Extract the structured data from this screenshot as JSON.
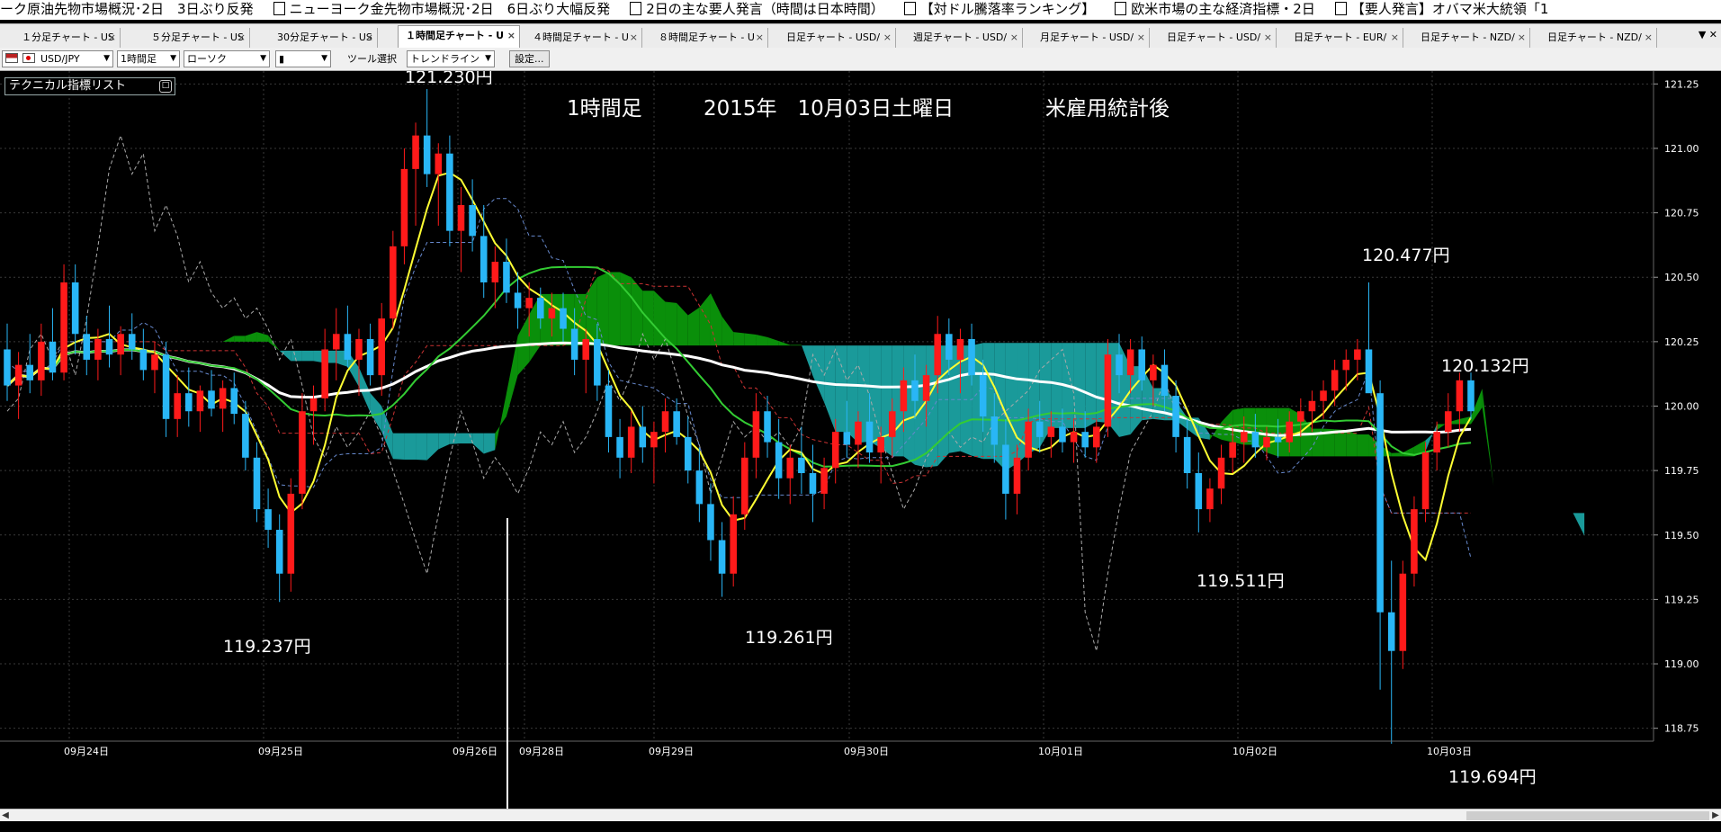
{
  "ticker": [
    "ーク原油先物市場概況･2日　3日ぶり反発",
    "ニューヨーク金先物市場概況･2日　6日ぶり大幅反発",
    "2日の主な要人発言（時間は日本時間）",
    "【対ドル騰落率ランキング】",
    "欧米市場の主な経済指標・2日",
    "【要人発言】オバマ米大統領「1"
  ],
  "tabs": [
    {
      "label": "１分足チャート - US",
      "x": 16,
      "w": 118
    },
    {
      "label": "５分足チャート - US",
      "x": 160,
      "w": 118
    },
    {
      "label": "30分足チャート - US",
      "x": 300,
      "w": 120
    },
    {
      "label": "１時間足チャート - U",
      "x": 442,
      "w": 128
    },
    {
      "label": "４時間足チャート - U",
      "x": 584,
      "w": 130
    },
    {
      "label": "８時間足チャート - U",
      "x": 724,
      "w": 130
    },
    {
      "label": "日足チャート - USD/",
      "x": 866,
      "w": 130
    },
    {
      "label": "週足チャート - USD/",
      "x": 1007,
      "w": 130
    },
    {
      "label": "月足チャート - USD/",
      "x": 1148,
      "w": 130
    },
    {
      "label": "日足チャート - USD/",
      "x": 1289,
      "w": 130
    },
    {
      "label": "日足チャート - EUR/",
      "x": 1430,
      "w": 130
    },
    {
      "label": "日足チャート - NZD/",
      "x": 1571,
      "w": 130
    },
    {
      "label": "日足チャート - NZD/",
      "x": 1712,
      "w": 130
    }
  ],
  "tab_close": "×",
  "tab_menu": "▼ ✕",
  "toolbar": {
    "pair": "USD/JPY",
    "period": "1時間足",
    "chart_type": "ローソク",
    "candle_icon": "▮",
    "tool_label": "ツール選択",
    "tool_value": "トレンドライン",
    "settings": "設定..."
  },
  "tech_panel": {
    "label": "テクニカル指標リスト",
    "button": "□"
  },
  "annotations": {
    "title_period": "1時間足",
    "title_date": "2015年　10月03日土曜日",
    "title_event": "米雇用統計後",
    "high": "121.230円",
    "low1": "119.237円",
    "low2": "119.261円",
    "low3": "119.511円",
    "high2": "120.477円",
    "last": "120.132円",
    "low4": "119.694円"
  },
  "chart_data": {
    "type": "candlestick",
    "symbol": "USD/JPY",
    "timeframe": "1時間足",
    "ylim": [
      118.7,
      121.3
    ],
    "y_ticks": [
      "121.25",
      "121.00",
      "120.75",
      "120.50",
      "120.25",
      "120.00",
      "119.75",
      "119.50",
      "119.25",
      "119.00",
      "118.75"
    ],
    "x_ticks": [
      "09月24日",
      "09月25日",
      "09月26日",
      "09月28日",
      "09月29日",
      "09月30日",
      "10月01日",
      "10月02日",
      "10月03日"
    ],
    "candle_count": 138,
    "candles": [
      [
        120.22,
        120.32,
        120.02,
        120.08
      ],
      [
        120.08,
        120.21,
        119.95,
        120.16
      ],
      [
        120.16,
        120.28,
        120.05,
        120.1
      ],
      [
        120.1,
        120.32,
        120.04,
        120.25
      ],
      [
        120.25,
        120.38,
        120.1,
        120.13
      ],
      [
        120.13,
        120.55,
        120.1,
        120.48
      ],
      [
        120.48,
        120.55,
        120.2,
        120.28
      ],
      [
        120.28,
        120.35,
        120.12,
        120.18
      ],
      [
        120.18,
        120.3,
        120.1,
        120.26
      ],
      [
        120.26,
        120.39,
        120.15,
        120.2
      ],
      [
        120.2,
        120.31,
        120.12,
        120.28
      ],
      [
        120.28,
        120.36,
        120.18,
        120.22
      ],
      [
        120.22,
        120.3,
        120.1,
        120.14
      ],
      [
        120.14,
        120.25,
        120.05,
        120.2
      ],
      [
        120.2,
        120.25,
        119.88,
        119.95
      ],
      [
        119.95,
        120.12,
        119.88,
        120.05
      ],
      [
        120.05,
        120.15,
        119.92,
        119.98
      ],
      [
        119.98,
        120.08,
        119.9,
        120.06
      ],
      [
        120.06,
        120.14,
        119.96,
        119.99
      ],
      [
        119.99,
        120.1,
        119.9,
        120.07
      ],
      [
        120.07,
        120.13,
        119.93,
        119.97
      ],
      [
        119.97,
        120.02,
        119.75,
        119.8
      ],
      [
        119.8,
        119.86,
        119.55,
        119.6
      ],
      [
        119.6,
        119.68,
        119.45,
        119.52
      ],
      [
        119.52,
        119.58,
        119.24,
        119.35
      ],
      [
        119.35,
        119.72,
        119.28,
        119.66
      ],
      [
        119.66,
        120.05,
        119.6,
        119.98
      ],
      [
        119.98,
        120.08,
        119.85,
        120.03
      ],
      [
        120.03,
        120.3,
        119.98,
        120.22
      ],
      [
        120.22,
        120.38,
        120.1,
        120.28
      ],
      [
        120.28,
        120.39,
        120.15,
        120.18
      ],
      [
        120.18,
        120.3,
        120.04,
        120.26
      ],
      [
        120.26,
        120.32,
        120.08,
        120.12
      ],
      [
        120.12,
        120.4,
        120.04,
        120.34
      ],
      [
        120.34,
        120.68,
        120.3,
        120.62
      ],
      [
        120.62,
        121.0,
        120.55,
        120.92
      ],
      [
        120.92,
        121.1,
        120.7,
        121.05
      ],
      [
        121.05,
        121.23,
        120.85,
        120.9
      ],
      [
        120.9,
        121.02,
        120.7,
        120.98
      ],
      [
        120.98,
        121.05,
        120.62,
        120.68
      ],
      [
        120.68,
        120.85,
        120.52,
        120.78
      ],
      [
        120.78,
        120.88,
        120.6,
        120.66
      ],
      [
        120.66,
        120.78,
        120.42,
        120.48
      ],
      [
        120.48,
        120.62,
        120.38,
        120.56
      ],
      [
        120.56,
        120.65,
        120.4,
        120.44
      ],
      [
        120.44,
        120.52,
        120.3,
        120.38
      ],
      [
        120.38,
        120.48,
        120.27,
        120.42
      ],
      [
        120.42,
        120.46,
        120.3,
        120.34
      ],
      [
        120.34,
        120.44,
        120.27,
        120.38
      ],
      [
        120.38,
        120.44,
        120.25,
        120.3
      ],
      [
        120.3,
        120.38,
        120.12,
        120.18
      ],
      [
        120.18,
        120.3,
        120.05,
        120.26
      ],
      [
        120.26,
        120.32,
        120.02,
        120.08
      ],
      [
        120.08,
        120.14,
        119.82,
        119.88
      ],
      [
        119.88,
        119.95,
        119.72,
        119.8
      ],
      [
        119.8,
        119.98,
        119.74,
        119.92
      ],
      [
        119.92,
        120.0,
        119.78,
        119.84
      ],
      [
        119.84,
        119.94,
        119.7,
        119.9
      ],
      [
        119.9,
        120.03,
        119.82,
        119.98
      ],
      [
        119.98,
        120.03,
        119.85,
        119.88
      ],
      [
        119.88,
        119.96,
        119.7,
        119.75
      ],
      [
        119.75,
        119.84,
        119.55,
        119.62
      ],
      [
        119.62,
        119.7,
        119.4,
        119.48
      ],
      [
        119.48,
        119.55,
        119.26,
        119.35
      ],
      [
        119.35,
        119.65,
        119.3,
        119.58
      ],
      [
        119.58,
        119.86,
        119.52,
        119.8
      ],
      [
        119.8,
        120.05,
        119.72,
        119.98
      ],
      [
        119.98,
        120.04,
        119.8,
        119.86
      ],
      [
        119.86,
        119.95,
        119.64,
        119.72
      ],
      [
        119.72,
        119.85,
        119.62,
        119.8
      ],
      [
        119.8,
        119.92,
        119.66,
        119.74
      ],
      [
        119.74,
        119.85,
        119.55,
        119.66
      ],
      [
        119.66,
        119.8,
        119.6,
        119.76
      ],
      [
        119.76,
        119.95,
        119.7,
        119.9
      ],
      [
        119.9,
        120.02,
        119.8,
        119.85
      ],
      [
        119.85,
        119.98,
        119.76,
        119.94
      ],
      [
        119.94,
        120.05,
        119.78,
        119.82
      ],
      [
        119.82,
        119.92,
        119.7,
        119.88
      ],
      [
        119.88,
        120.03,
        119.8,
        119.98
      ],
      [
        119.98,
        120.15,
        119.9,
        120.1
      ],
      [
        120.1,
        120.2,
        119.95,
        120.02
      ],
      [
        120.02,
        120.16,
        119.92,
        120.12
      ],
      [
        120.12,
        120.35,
        120.05,
        120.28
      ],
      [
        120.28,
        120.34,
        120.12,
        120.18
      ],
      [
        120.18,
        120.3,
        120.05,
        120.26
      ],
      [
        120.26,
        120.32,
        120.08,
        120.12
      ],
      [
        120.12,
        120.18,
        119.9,
        119.96
      ],
      [
        119.96,
        120.05,
        119.78,
        119.85
      ],
      [
        119.85,
        119.95,
        119.56,
        119.66
      ],
      [
        119.66,
        119.85,
        119.58,
        119.8
      ],
      [
        119.8,
        119.99,
        119.75,
        119.94
      ],
      [
        119.94,
        120.02,
        119.82,
        119.88
      ],
      [
        119.88,
        119.98,
        119.8,
        119.92
      ],
      [
        119.92,
        119.99,
        119.82,
        119.86
      ],
      [
        119.86,
        119.95,
        119.78,
        119.9
      ],
      [
        119.9,
        119.98,
        119.8,
        119.84
      ],
      [
        119.84,
        119.95,
        119.78,
        119.92
      ],
      [
        119.92,
        120.26,
        119.88,
        120.2
      ],
      [
        120.2,
        120.28,
        120.05,
        120.12
      ],
      [
        120.12,
        120.26,
        120.05,
        120.22
      ],
      [
        120.22,
        120.27,
        120.06,
        120.1
      ],
      [
        120.1,
        120.2,
        120.0,
        120.16
      ],
      [
        120.16,
        120.22,
        119.98,
        120.04
      ],
      [
        120.04,
        120.1,
        119.82,
        119.88
      ],
      [
        119.88,
        119.95,
        119.68,
        119.74
      ],
      [
        119.74,
        119.82,
        119.51,
        119.6
      ],
      [
        119.6,
        119.72,
        119.55,
        119.68
      ],
      [
        119.68,
        119.85,
        119.62,
        119.8
      ],
      [
        119.8,
        119.92,
        119.74,
        119.86
      ],
      [
        119.86,
        119.96,
        119.78,
        119.9
      ],
      [
        119.9,
        119.97,
        119.8,
        119.84
      ],
      [
        119.84,
        119.92,
        119.79,
        119.88
      ],
      [
        119.88,
        119.95,
        119.8,
        119.86
      ],
      [
        119.86,
        119.98,
        119.82,
        119.94
      ],
      [
        119.94,
        120.03,
        119.88,
        119.98
      ],
      [
        119.98,
        120.06,
        119.9,
        120.02
      ],
      [
        120.02,
        120.1,
        119.95,
        120.06
      ],
      [
        120.06,
        120.18,
        120.0,
        120.14
      ],
      [
        120.14,
        120.22,
        120.06,
        120.18
      ],
      [
        120.18,
        120.26,
        120.1,
        120.22
      ],
      [
        120.22,
        120.48,
        120.15,
        120.05
      ],
      [
        120.05,
        120.1,
        118.9,
        119.2
      ],
      [
        119.2,
        119.4,
        118.69,
        119.05
      ],
      [
        119.05,
        119.4,
        118.98,
        119.35
      ],
      [
        119.35,
        119.65,
        119.3,
        119.6
      ],
      [
        119.6,
        119.86,
        119.55,
        119.82
      ],
      [
        119.82,
        119.94,
        119.75,
        119.9
      ],
      [
        119.9,
        120.05,
        119.84,
        119.98
      ],
      [
        119.98,
        120.13,
        119.9,
        120.1
      ],
      [
        120.1,
        120.13,
        119.95,
        119.98
      ]
    ]
  },
  "colors": {
    "up": "#ff1a1a",
    "down": "#29b6f6",
    "kumo_bull": "#0a8f0a",
    "kumo_bear": "#1a9a9a",
    "ma_long": "#ffffff",
    "ma_short": "#ffff33",
    "ma_mid": "#33cc33",
    "grid": "#3a3a3a",
    "axis_text": "#ffffff"
  }
}
